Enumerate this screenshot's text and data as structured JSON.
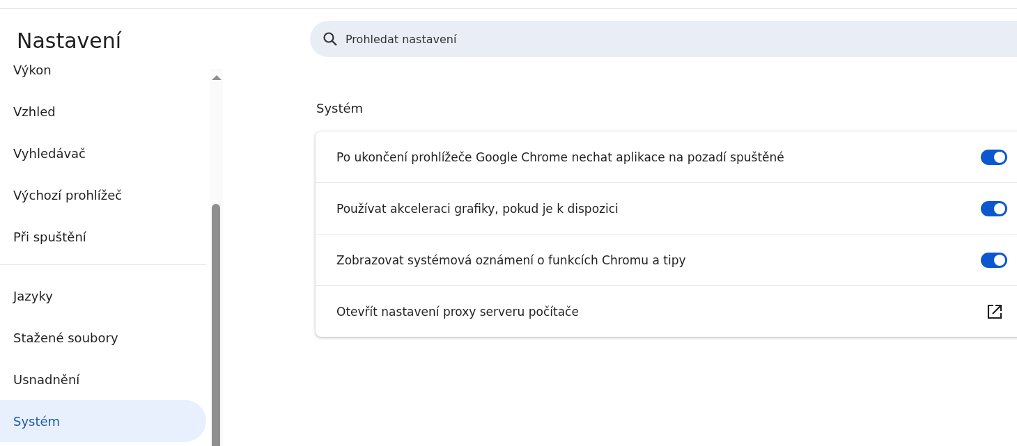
{
  "sidebar": {
    "title": "Nastavení",
    "groups": [
      {
        "items": [
          {
            "label": "Výkon",
            "selected": false
          },
          {
            "label": "Vzhled",
            "selected": false
          },
          {
            "label": "Vyhledávač",
            "selected": false
          },
          {
            "label": "Výchozí prohlížeč",
            "selected": false
          },
          {
            "label": "Při spuštění",
            "selected": false
          }
        ]
      },
      {
        "items": [
          {
            "label": "Jazyky",
            "selected": false
          },
          {
            "label": "Stažené soubory",
            "selected": false
          },
          {
            "label": "Usnadnění",
            "selected": false
          },
          {
            "label": "Systém",
            "selected": true
          }
        ]
      }
    ]
  },
  "search": {
    "placeholder": "Prohledat nastavení"
  },
  "section": {
    "title": "Systém",
    "rows": [
      {
        "kind": "toggle",
        "label": "Po ukončení prohlížeče Google Chrome nechat aplikace na pozadí spuštěné",
        "on": true
      },
      {
        "kind": "toggle",
        "label": "Používat akceleraci grafiky, pokud je k dispozici",
        "on": true
      },
      {
        "kind": "toggle",
        "label": "Zobrazovat systémová oznámení o funkcích Chromu a tipy",
        "on": true
      },
      {
        "kind": "link",
        "label": "Otevřít nastavení proxy serveru počítače"
      }
    ]
  }
}
